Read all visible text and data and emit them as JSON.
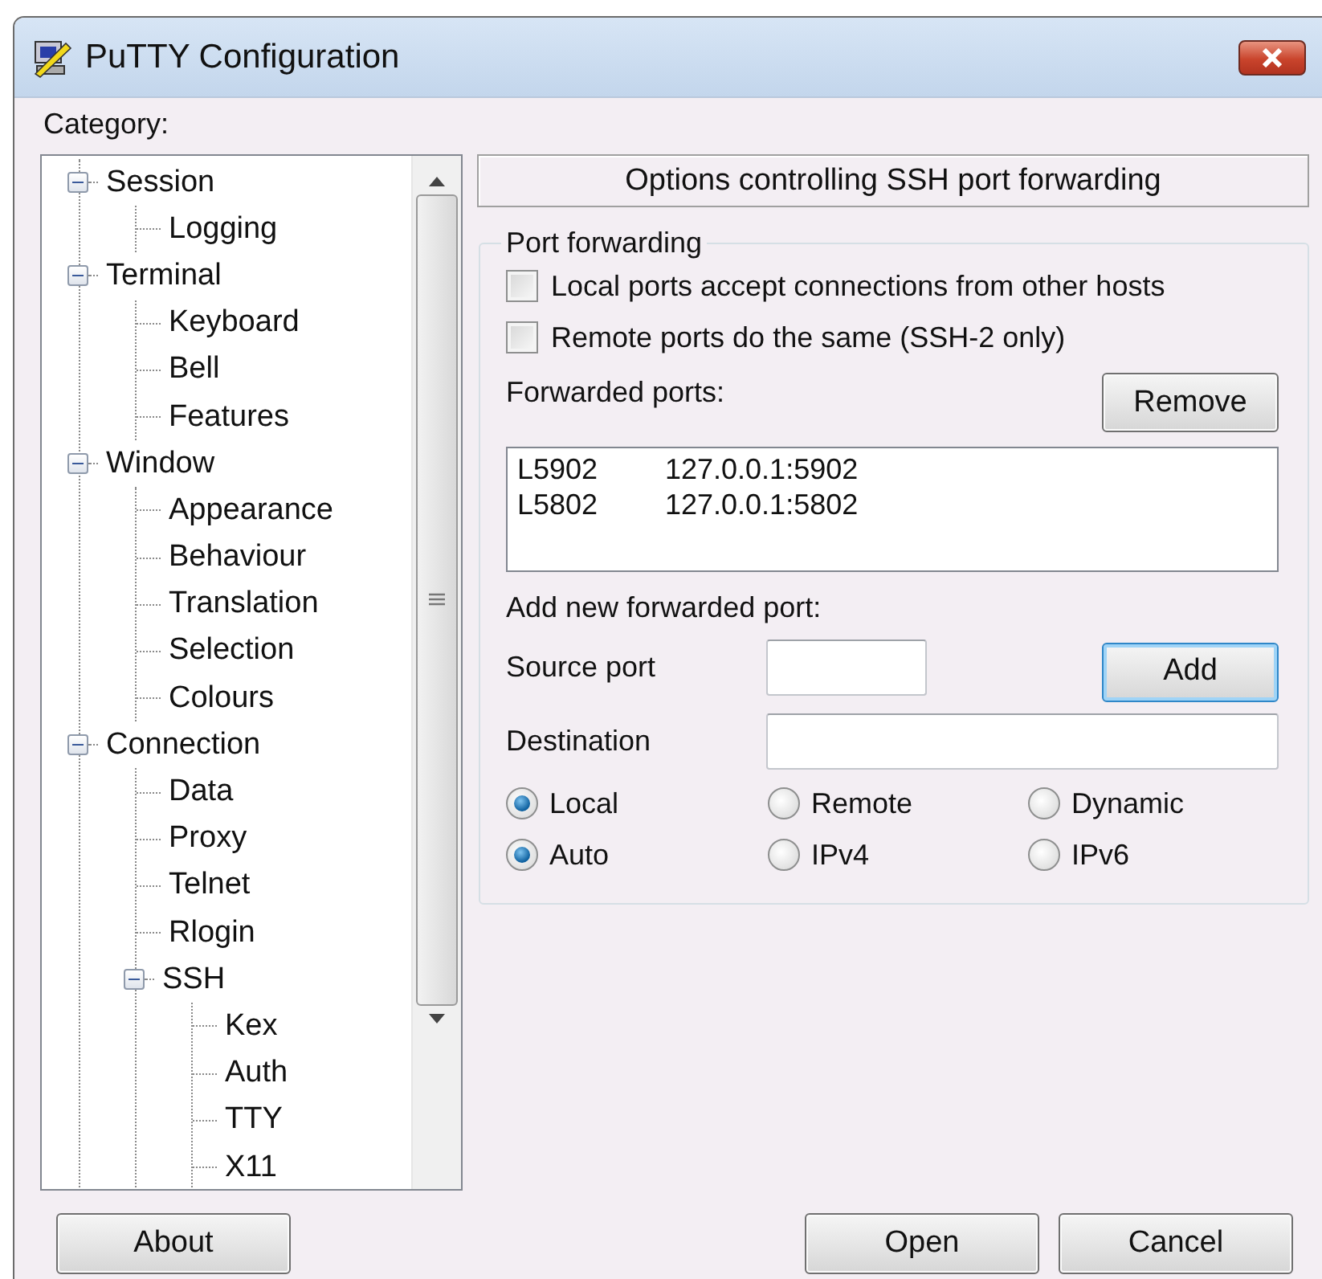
{
  "window": {
    "title": "PuTTY Configuration"
  },
  "category_label": {
    "text": "Category:"
  },
  "tree": [
    {
      "label": "Session",
      "expanded": true,
      "children": [
        {
          "label": "Logging"
        }
      ]
    },
    {
      "label": "Terminal",
      "expanded": true,
      "children": [
        {
          "label": "Keyboard"
        },
        {
          "label": "Bell"
        },
        {
          "label": "Features"
        }
      ]
    },
    {
      "label": "Window",
      "expanded": true,
      "children": [
        {
          "label": "Appearance"
        },
        {
          "label": "Behaviour"
        },
        {
          "label": "Translation"
        },
        {
          "label": "Selection"
        },
        {
          "label": "Colours"
        }
      ]
    },
    {
      "label": "Connection",
      "expanded": true,
      "children": [
        {
          "label": "Data"
        },
        {
          "label": "Proxy"
        },
        {
          "label": "Telnet"
        },
        {
          "label": "Rlogin"
        },
        {
          "label": "SSH",
          "expanded": true,
          "children": [
            {
              "label": "Kex"
            },
            {
              "label": "Auth"
            },
            {
              "label": "TTY"
            },
            {
              "label": "X11"
            }
          ]
        }
      ]
    }
  ],
  "panel": {
    "header": "Options controlling SSH port forwarding",
    "group": {
      "legend": "Port forwarding",
      "checkboxes": [
        {
          "label": "Local ports accept connections from other hosts",
          "checked": false
        },
        {
          "label": "Remote ports do the same (SSH-2 only)",
          "checked": false
        }
      ],
      "forwarded_label": "Forwarded ports:",
      "remove_button": {
        "label": "Remove",
        "default": false
      },
      "forwarded_ports": [
        {
          "source": "L5902",
          "destination": "127.0.0.1:5902"
        },
        {
          "source": "L5802",
          "destination": "127.0.0.1:5802"
        }
      ],
      "add_label": "Add new forwarded port:",
      "source_port": {
        "label": "Source port"
      },
      "add_button": {
        "label": "Add",
        "default": true
      },
      "destination": {
        "label": "Destination"
      },
      "radio_groups": [
        [
          {
            "label": "Local",
            "selected": true
          },
          {
            "label": "Remote",
            "selected": false
          },
          {
            "label": "Dynamic",
            "selected": false
          }
        ],
        [
          {
            "label": "Auto",
            "selected": true
          },
          {
            "label": "IPv4",
            "selected": false
          },
          {
            "label": "IPv6",
            "selected": false
          }
        ]
      ]
    }
  },
  "buttons": [
    {
      "label": "About",
      "default": false
    },
    {
      "label": "Open",
      "default": false
    },
    {
      "label": "Cancel",
      "default": false
    }
  ]
}
